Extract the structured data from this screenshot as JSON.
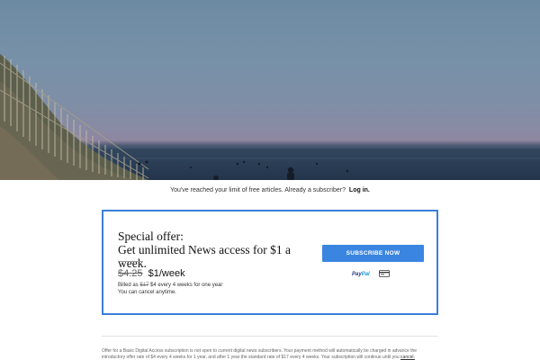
{
  "banner": {
    "limit_text": "You've reached your limit of free articles. Already a subscriber?",
    "login_label": "Log in."
  },
  "offer": {
    "heading_line1": "Special offer:",
    "heading_line2": "Get unlimited News access for $1 a week.",
    "old_price": "$4.25",
    "new_price": "$1/week",
    "billed_prefix": "Billed as",
    "billed_strike": "$17",
    "billed_rest": "$4 every 4 weeks for one year",
    "cancel_note": "You can cancel anytime.",
    "subscribe_label": "SUBSCRIBE NOW",
    "paypal_pay": "Pay",
    "paypal_pal": "Pal",
    "card_icon": "credit-card-icon"
  },
  "fine_print": {
    "text": "Offer for a Basic Digital Access subscription is not open to current digital news subscribers. Your payment method will automatically be charged in advance the introductory offer rate of $4 every 4 weeks for 1 year, and after 1 year the standard rate of $17 every 4 weeks. Your subscription will continue until you",
    "cancel_link": "cancel."
  },
  "colors": {
    "accent": "#3a85e0",
    "card_border": "#3a7fd8"
  }
}
